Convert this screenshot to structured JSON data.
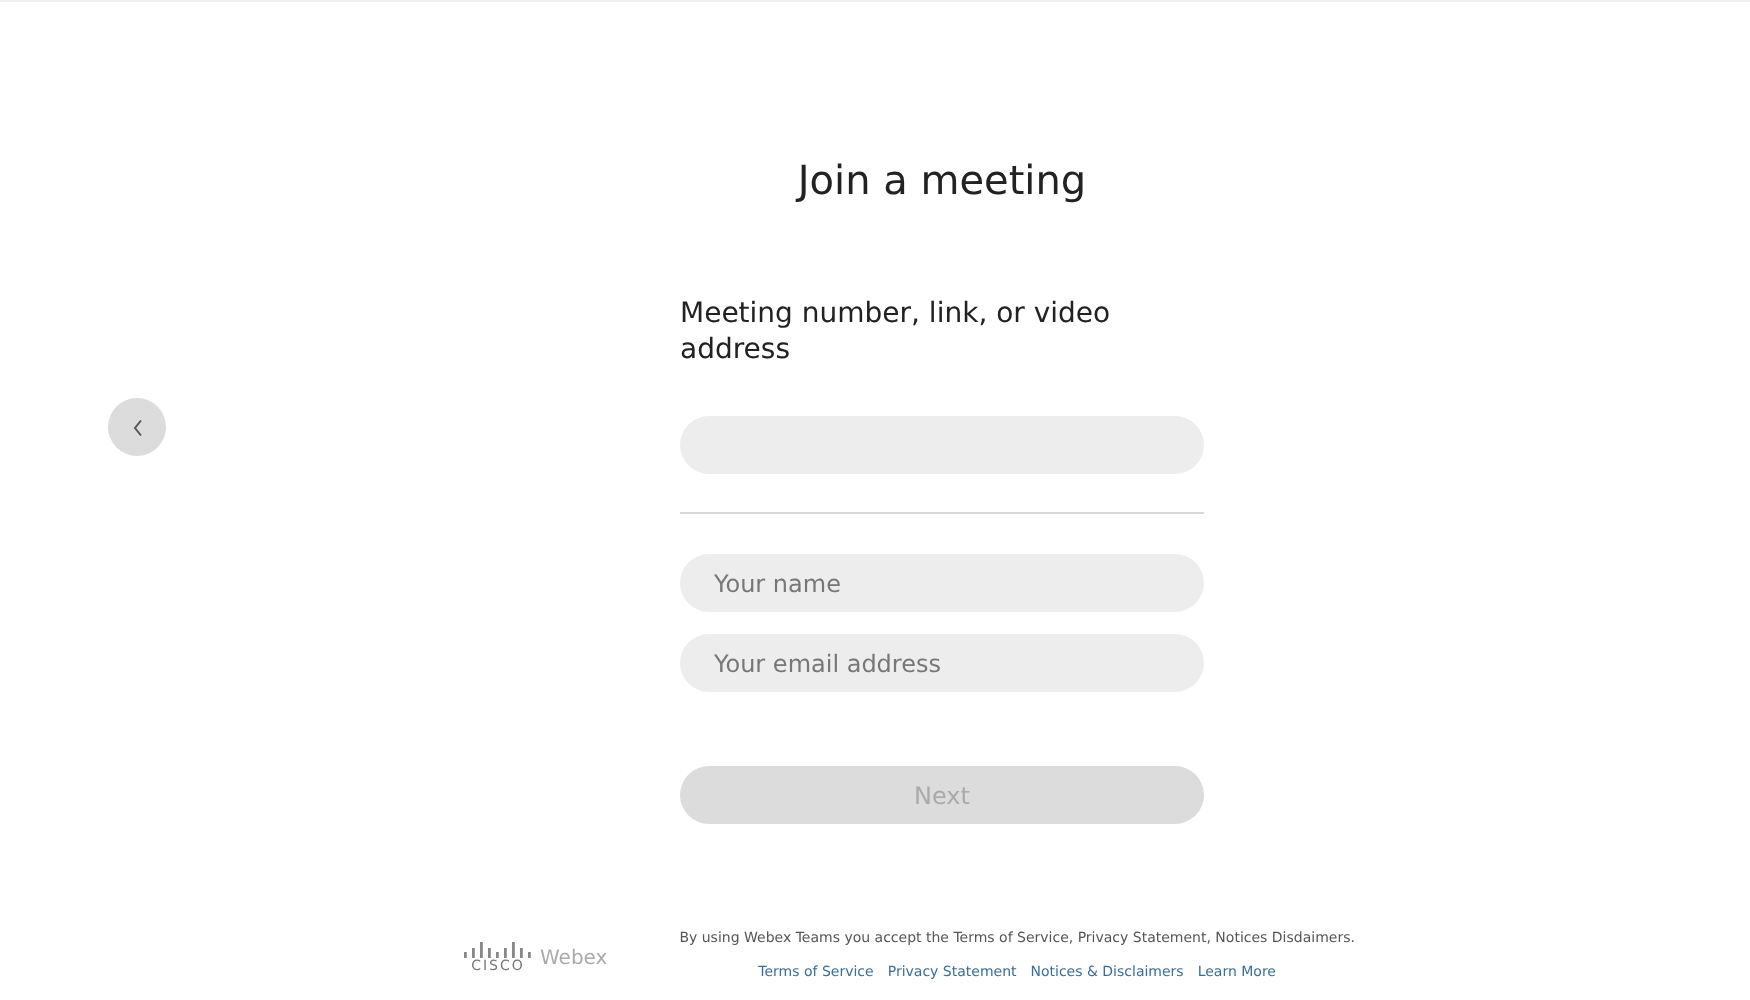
{
  "title": "Join a meeting",
  "meeting_label": "Meeting number, link, or video address",
  "fields": [
    {
      "placeholder": "Your name"
    },
    {
      "placeholder": "Your email address"
    }
  ],
  "next_button": {
    "label": "Next",
    "disabled": true
  },
  "footer": {
    "logo_word": "CISCO",
    "product": "Webex",
    "notice": "By using Webex Teams you accept the Terms of Service, Privacy Statement, Notices  Disdaimers.",
    "links": [
      "Terms of Service",
      "Privacy Statement",
      "Notices & Disclaimers",
      "Learn More"
    ]
  }
}
